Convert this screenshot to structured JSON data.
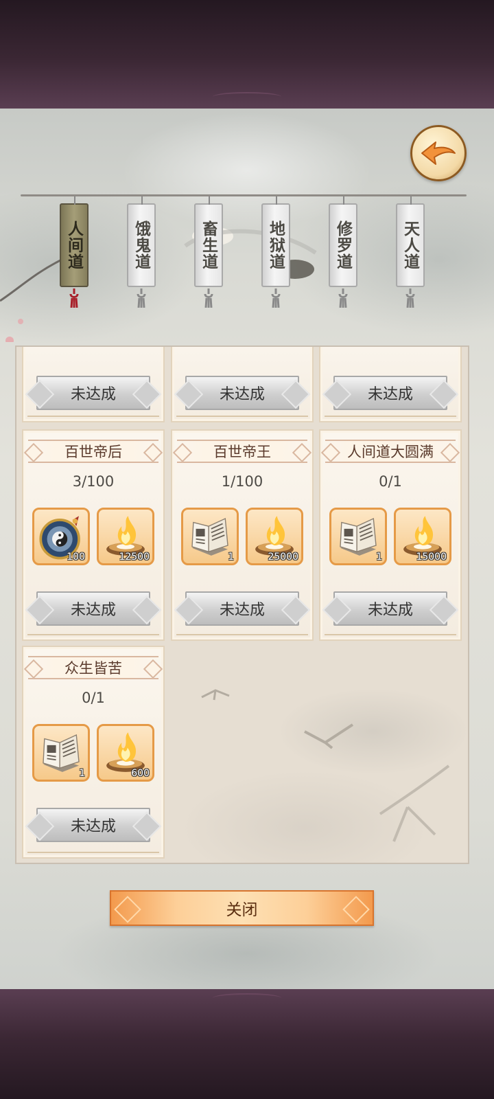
{
  "tabs": [
    {
      "label": "人间道",
      "active": true
    },
    {
      "label": "饿鬼道",
      "active": false
    },
    {
      "label": "畜生道",
      "active": false
    },
    {
      "label": "地狱道",
      "active": false
    },
    {
      "label": "修罗道",
      "active": false
    },
    {
      "label": "天人道",
      "active": false
    }
  ],
  "cards": [
    {
      "title": "",
      "progress": "",
      "status": "未达成",
      "rewards": []
    },
    {
      "title": "",
      "progress": "",
      "status": "未达成",
      "rewards": []
    },
    {
      "title": "",
      "progress": "",
      "status": "未达成",
      "rewards": []
    },
    {
      "title": "百世帝后",
      "progress": "3/100",
      "status": "未达成",
      "rewards": [
        {
          "icon": "bagua-compass-icon",
          "count": "100"
        },
        {
          "icon": "spirit-flame-icon",
          "count": "12500"
        }
      ]
    },
    {
      "title": "百世帝王",
      "progress": "1/100",
      "status": "未达成",
      "rewards": [
        {
          "icon": "scripture-book-icon",
          "count": "1"
        },
        {
          "icon": "spirit-flame-icon",
          "count": "25000"
        }
      ]
    },
    {
      "title": "人间道大圆满",
      "progress": "0/1",
      "status": "未达成",
      "rewards": [
        {
          "icon": "scripture-book-icon",
          "count": "1"
        },
        {
          "icon": "spirit-flame-icon",
          "count": "15000"
        }
      ]
    },
    {
      "title": "众生皆苦",
      "progress": "0/1",
      "status": "未达成",
      "rewards": [
        {
          "icon": "scripture-book-icon",
          "count": "1"
        },
        {
          "icon": "spirit-flame-icon",
          "count": "600"
        }
      ]
    }
  ],
  "close_label": "关闭",
  "colors": {
    "accent": "#e59a47",
    "frame": "#3b2734",
    "active_tab": "#a59e78"
  }
}
